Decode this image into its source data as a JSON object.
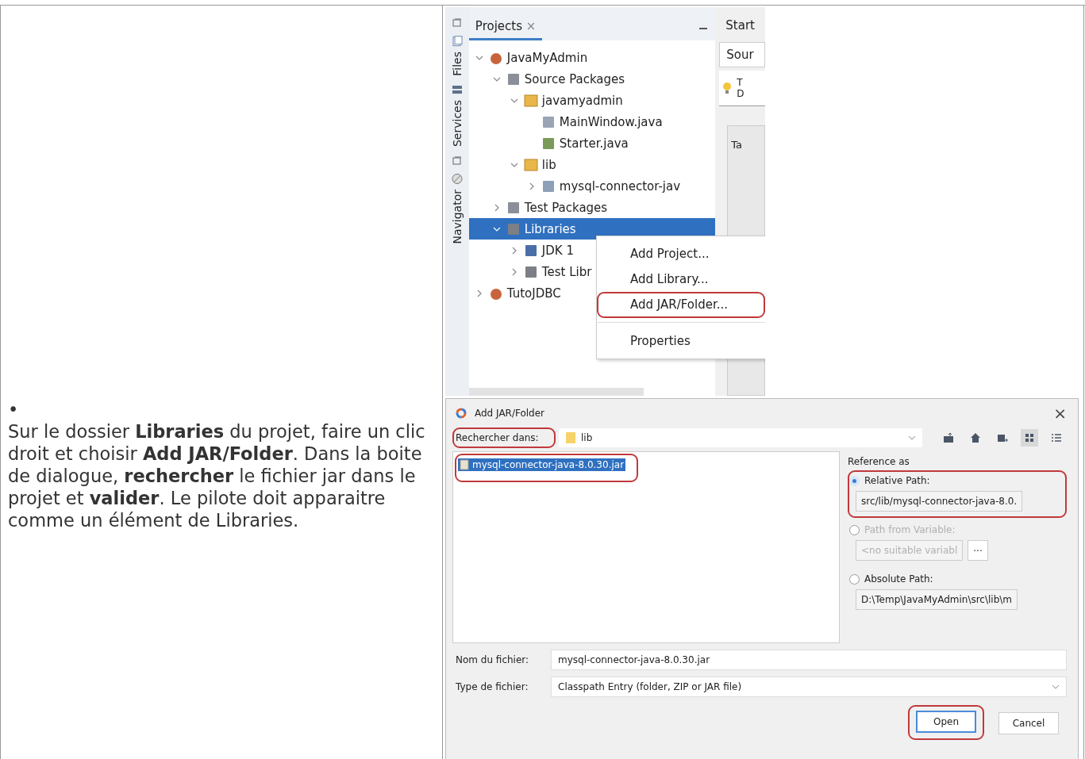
{
  "instruction": {
    "bullet": "•",
    "text": "Sur le dossier **Libraries** du projet, faire un clic droit et choisir **Add JAR/Folder**. Dans la boite de dialogue, **rechercher** le fichier jar dans le projet et **valider**. Le pilote doit apparaitre comme un élément de Libraries."
  },
  "ide": {
    "side_tabs": [
      {
        "label": "Files",
        "kind": "files"
      },
      {
        "label": "Services",
        "kind": "services"
      },
      {
        "label": "Navigator",
        "kind": "navigator"
      }
    ],
    "panel_tab": {
      "label": "Projects",
      "close": "×"
    },
    "editor": {
      "tab": "Start",
      "subtab": "Sour",
      "hint_lines": [
        "T",
        "D"
      ],
      "inner_tab": "Ta"
    },
    "tree": [
      {
        "label": "JavaMyAdmin",
        "kind": "project",
        "expanded": true,
        "selected": false,
        "children": [
          {
            "label": "Source Packages",
            "kind": "packages",
            "expanded": true,
            "selected": false,
            "children": [
              {
                "label": "javamyadmin",
                "kind": "package",
                "expanded": true,
                "selected": false,
                "children": [
                  {
                    "label": "MainWindow.java",
                    "kind": "form",
                    "selected": false
                  },
                  {
                    "label": "Starter.java",
                    "kind": "java",
                    "selected": false
                  }
                ]
              },
              {
                "label": "lib",
                "kind": "package",
                "expanded": true,
                "selected": false,
                "children": [
                  {
                    "label": "mysql-connector-jav",
                    "kind": "jar",
                    "expanded": false,
                    "selected": false
                  }
                ]
              }
            ]
          },
          {
            "label": "Test Packages",
            "kind": "packages",
            "expanded": false,
            "selected": false
          },
          {
            "label": "Libraries",
            "kind": "libraries",
            "expanded": true,
            "selected": true,
            "children": [
              {
                "label": "JDK 1",
                "kind": "jdk",
                "expanded": false,
                "selected": false
              },
              {
                "label": "Test Libr",
                "kind": "libraries",
                "expanded": false,
                "selected": false
              }
            ]
          }
        ]
      },
      {
        "label": "TutoJDBC",
        "kind": "project",
        "expanded": false,
        "selected": false
      }
    ],
    "context_menu": {
      "items": [
        {
          "label": "Add Project...",
          "highlighted": false,
          "separator_after": false
        },
        {
          "label": "Add Library...",
          "highlighted": false,
          "separator_after": false
        },
        {
          "label": "Add JAR/Folder...",
          "highlighted": true,
          "separator_after": true
        },
        {
          "label": "Properties",
          "highlighted": false,
          "separator_after": false
        }
      ]
    }
  },
  "dialog": {
    "title": "Add JAR/Folder",
    "close": "×",
    "look_in": {
      "label": "Rechercher dans:",
      "value": "lib",
      "highlighted": true
    },
    "toolbar": [
      {
        "kind": "up",
        "selected": false
      },
      {
        "kind": "home",
        "selected": false
      },
      {
        "kind": "new-folder",
        "selected": false
      },
      {
        "kind": "grid",
        "selected": true
      },
      {
        "kind": "list",
        "selected": false
      }
    ],
    "files": [
      {
        "name": "mysql-connector-java-8.0.30.jar",
        "selected": true,
        "highlighted": true
      }
    ],
    "reference": {
      "label": "Reference as",
      "options": [
        {
          "label": "Relative Path:",
          "selected": true,
          "disabled": false,
          "highlighted": true,
          "value": "src/lib/mysql-connector-java-8.0."
        },
        {
          "label": "Path from Variable:",
          "selected": false,
          "disabled": true,
          "highlighted": false,
          "value": "<no suitable variabl",
          "button": "..."
        },
        {
          "label": "Absolute Path:",
          "selected": false,
          "disabled": false,
          "highlighted": false,
          "value": "D:\\Temp\\JavaMyAdmin\\src\\lib\\m"
        }
      ]
    },
    "file_name": {
      "label": "Nom du fichier:",
      "value": "mysql-connector-java-8.0.30.jar"
    },
    "file_type": {
      "label": "Type de fichier:",
      "value": "Classpath Entry (folder, ZIP or JAR file)"
    },
    "buttons": [
      {
        "label": "Open",
        "highlighted": true,
        "default": true
      },
      {
        "label": "Cancel",
        "highlighted": false,
        "default": false
      }
    ]
  }
}
